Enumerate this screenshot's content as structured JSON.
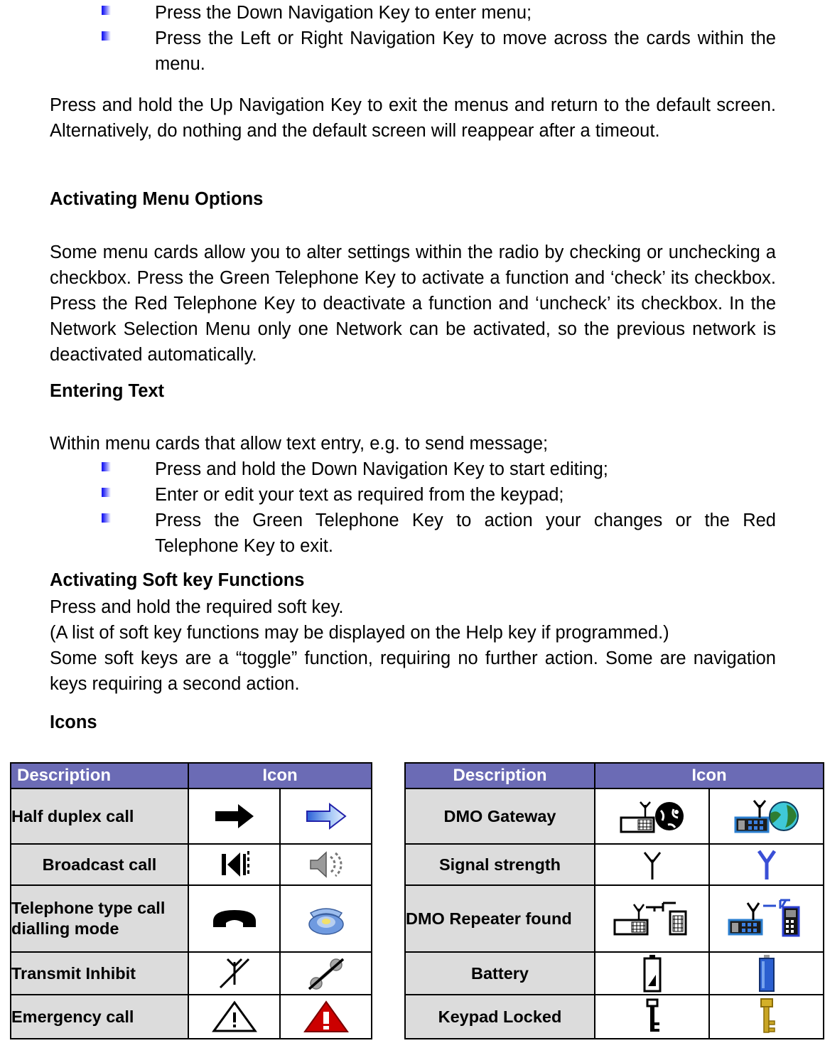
{
  "document": {
    "top_bullets": [
      "Press the Down Navigation Key to enter menu;",
      "Press the Left or Right Navigation Key to move across the cards within the menu."
    ],
    "paragraph_exit_menu": "Press and hold the Up Navigation Key to exit the menus and return to the default screen. Alternatively, do nothing and the default screen will reappear after a timeout.",
    "heading_activating_menu_options": "Activating Menu Options",
    "paragraph_menu_options": "Some menu cards allow you to alter settings within the radio by checking or unchecking a checkbox. Press the Green Telephone Key to activate a function and ‘check’ its checkbox. Press the Red Telephone Key to deactivate a function and ‘uncheck’ its checkbox. In the Network Selection Menu only one Network can be activated, so the previous network is deactivated automatically.",
    "heading_entering_text": "Entering Text",
    "paragraph_entering_text_intro": "Within menu cards that allow text entry, e.g. to send message;",
    "entering_text_bullets": [
      "Press and hold the Down Navigation Key to start editing;",
      "Enter or edit your text as required from the keypad;",
      "Press the Green Telephone Key to action your changes or the Red Telephone Key to exit."
    ],
    "heading_soft_key": "Activating Soft key Functions",
    "soft_key_lines": [
      "Press and hold the required soft key.",
      "(A list of soft key functions may be displayed on the Help key if programmed.)",
      "Some soft keys are a “toggle” function, requiring no further action. Some are navigation keys requiring a second action."
    ],
    "heading_icons": "Icons"
  },
  "tables": {
    "left": {
      "headers": {
        "description": "Description",
        "icon": "Icon"
      },
      "rows": [
        {
          "description": "Half duplex call",
          "align": "left",
          "mono_icon": "arrow-right-mono-icon",
          "color_icon": "arrow-right-color-icon"
        },
        {
          "description": "Broadcast call",
          "align": "center",
          "mono_icon": "loudspeaker-mono-icon",
          "color_icon": "loudspeaker-color-icon"
        },
        {
          "description": "Telephone type call dialling mode",
          "align": "left",
          "mono_icon": "telephone-mono-icon",
          "color_icon": "telephone-color-icon"
        },
        {
          "description": "Transmit Inhibit",
          "align": "left",
          "mono_icon": "transmit-inhibit-mono-icon",
          "color_icon": "transmit-inhibit-color-icon"
        },
        {
          "description": "Emergency call",
          "align": "left",
          "mono_icon": "warning-triangle-mono-icon",
          "color_icon": "warning-triangle-color-icon"
        }
      ]
    },
    "right": {
      "headers": {
        "description": "Description",
        "icon": "Icon"
      },
      "rows": [
        {
          "description": "DMO Gateway",
          "align": "center",
          "mono_icon": "dmo-gateway-mono-icon",
          "color_icon": "dmo-gateway-color-icon"
        },
        {
          "description": "Signal strength",
          "align": "center",
          "mono_icon": "antenna-mono-icon",
          "color_icon": "antenna-color-icon"
        },
        {
          "description": "DMO Repeater found",
          "align": "left",
          "mono_icon": "dmo-repeater-mono-icon",
          "color_icon": "dmo-repeater-color-icon"
        },
        {
          "description": "Battery",
          "align": "center",
          "mono_icon": "battery-mono-icon",
          "color_icon": "battery-color-icon"
        },
        {
          "description": "Keypad Locked",
          "align": "center",
          "mono_icon": "key-mono-icon",
          "color_icon": "key-color-icon"
        }
      ]
    }
  },
  "colors": {
    "table_header_purple": "#6B6BB5",
    "description_cell_gray": "#DCDCDC",
    "bullet_blue": "#1414F0",
    "emergency_red": "#CC0000",
    "battery_blue": "#2B5FD0",
    "key_gold": "#B8960B"
  }
}
